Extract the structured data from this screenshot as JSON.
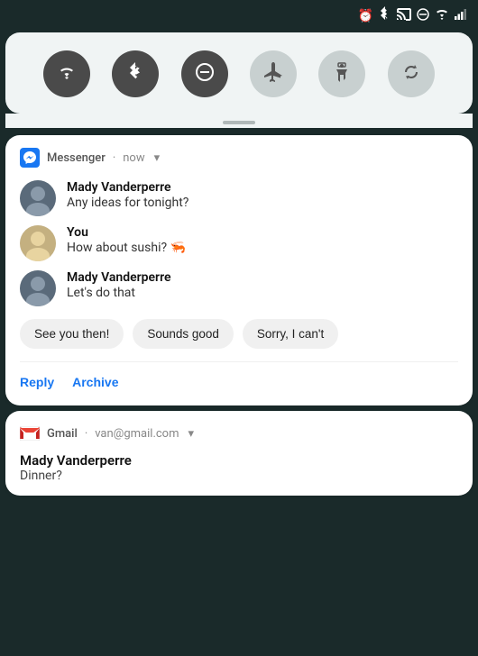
{
  "statusBar": {
    "icons": [
      "alarm",
      "bluetooth",
      "cast",
      "dnd",
      "wifi",
      "signal"
    ]
  },
  "quickSettings": {
    "buttons": [
      {
        "id": "wifi",
        "label": "WiFi",
        "active": true,
        "icon": "▼"
      },
      {
        "id": "bluetooth",
        "label": "Bluetooth",
        "active": true,
        "icon": "ʙ"
      },
      {
        "id": "dnd",
        "label": "Do Not Disturb",
        "active": true,
        "icon": "—"
      },
      {
        "id": "airplane",
        "label": "Airplane Mode",
        "active": false,
        "icon": "✈"
      },
      {
        "id": "flashlight",
        "label": "Flashlight",
        "active": false,
        "icon": "🔦"
      },
      {
        "id": "rotate",
        "label": "Auto Rotate",
        "active": false,
        "icon": "⟳"
      }
    ]
  },
  "messengerNotification": {
    "appName": "Messenger",
    "time": "now",
    "messages": [
      {
        "sender": "Mady Vanderperre",
        "text": "Any ideas for tonight?",
        "isYou": false
      },
      {
        "sender": "You",
        "text": "How about sushi? 🦐",
        "isYou": true
      },
      {
        "sender": "Mady Vanderperre",
        "text": "Let's do that",
        "isYou": false
      }
    ],
    "quickReplies": [
      "See you then!",
      "Sounds good",
      "Sorry, I can't"
    ],
    "actions": [
      {
        "id": "reply",
        "label": "Reply"
      },
      {
        "id": "archive",
        "label": "Archive"
      }
    ]
  },
  "gmailNotification": {
    "appName": "Gmail",
    "account": "van@gmail.com",
    "sender": "Mady Vanderperre",
    "subject": "Dinner?"
  }
}
